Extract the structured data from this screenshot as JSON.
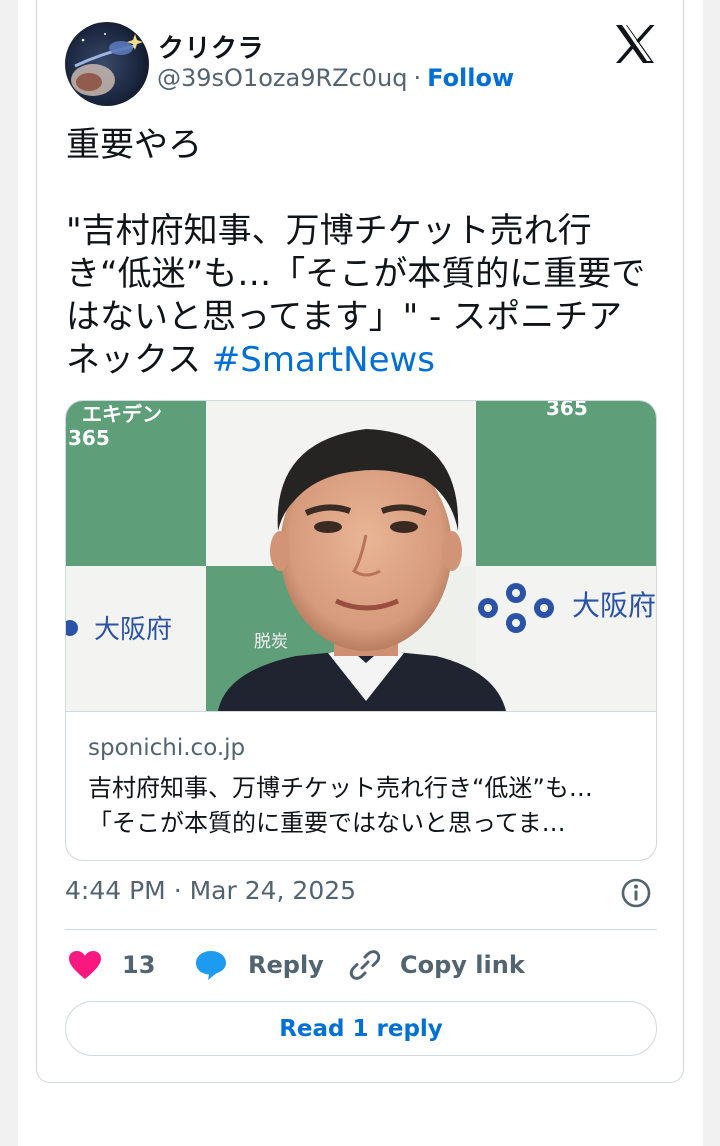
{
  "author": {
    "display_name": "クリクラ",
    "handle": "@39sO1oza9RZc0uq",
    "separator": "·",
    "follow_label": "Follow"
  },
  "tweet": {
    "line_1": "重要やろ",
    "line_2": "\"吉村府知事、万博チケット売れ行き“低迷”も…「そこが本質的に重要ではないと思ってます」\" - スポニチアネックス ",
    "hashtag": "#SmartNews"
  },
  "link_card": {
    "domain": "sponichi.co.jp",
    "title_line_1": "吉村府知事、万博チケット売れ行き“低迷”も…",
    "title_line_2": "「そこが本質的に重要ではないと思ってま…"
  },
  "meta": {
    "time": "4:44 PM",
    "separator": "·",
    "date": "Mar 24, 2025"
  },
  "actions": {
    "like_count": "13",
    "reply_label": "Reply",
    "copy_link_label": "Copy link"
  },
  "read_reply_label": "Read 1 reply",
  "icons": {
    "x_logo": "x-logo-icon",
    "heart": "heart-icon",
    "reply": "speech-bubble-icon",
    "link": "link-icon",
    "info": "info-icon"
  },
  "colors": {
    "link_blue": "#006fd6",
    "heart": "#f91880",
    "reply_bubble": "#1d9bf0",
    "secondary_text": "#536471",
    "border": "#cfd9de"
  },
  "image_text": {
    "left_sign": "エキデン",
    "left_number": "365",
    "right_number": "365",
    "prefecture_left": "大阪府",
    "prefecture_right": "大阪府",
    "logo_text": "脱炭"
  }
}
